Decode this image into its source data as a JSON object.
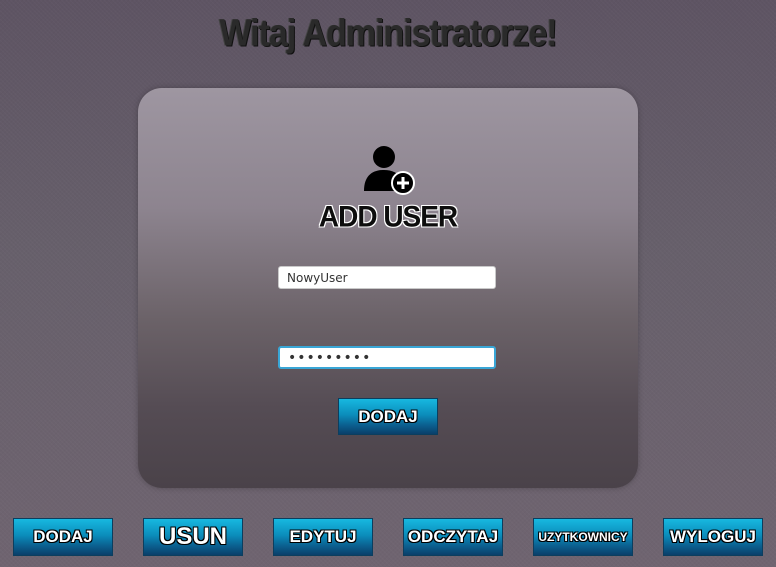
{
  "header": {
    "title": "Witaj Administratorze!"
  },
  "form": {
    "icon": "add-user-icon",
    "heading": "ADD USER",
    "username_value": "NowyUser",
    "password_value": "•••••••••",
    "submit_label": "DODAJ"
  },
  "nav": {
    "items": [
      {
        "label": "DODAJ",
        "icon": "none"
      },
      {
        "label": "USUN",
        "icon": "none"
      },
      {
        "label": "EDYTUJ",
        "icon": "none"
      },
      {
        "label": "ODCZYTAJ",
        "icon": "none"
      },
      {
        "label": "UZYTKOWNICY",
        "icon": "none"
      },
      {
        "label": "WYLOGUJ",
        "icon": "none"
      }
    ]
  },
  "colors": {
    "button_top": "#17b8e0",
    "button_bottom": "#0a3f6a",
    "focus_border": "#39a6d6"
  }
}
